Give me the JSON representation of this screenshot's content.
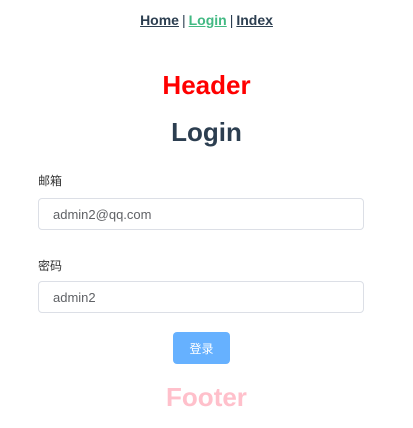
{
  "nav": {
    "home": "Home",
    "login": "Login",
    "index": "Index",
    "separator": "|",
    "active_color": "#42b983"
  },
  "header": {
    "title": "Header",
    "color": "#ff0000"
  },
  "page_title": "Login",
  "form": {
    "email_label": "邮箱",
    "email_value": "admin2@qq.com",
    "password_label": "密码",
    "password_value": "admin2",
    "submit_label": "登录",
    "submit_color": "#66b1ff"
  },
  "footer": {
    "title": "Footer",
    "color": "#ffc0cb"
  }
}
